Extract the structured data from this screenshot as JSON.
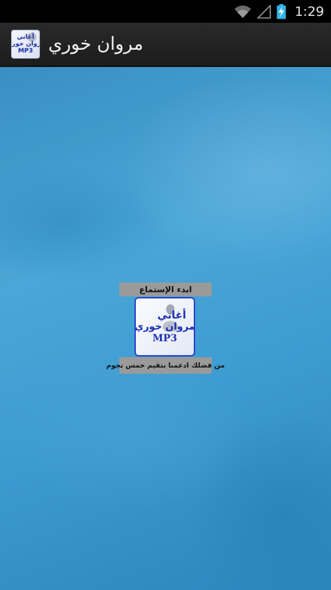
{
  "status_bar": {
    "time": "1:29",
    "icons": [
      "wifi-icon",
      "signal-icon",
      "battery-charging-icon"
    ]
  },
  "action_bar": {
    "title": "مروان خوري",
    "icon_lines": [
      "أغاني",
      "مروان خوري",
      "MP3"
    ]
  },
  "main": {
    "listen_label": "ابدء الإستماع",
    "album_art_lines": [
      "أغاني",
      "مروان خوري",
      "MP3"
    ],
    "rate_label": "من فضلك ادعمنا بتقيم خمس نجوم"
  },
  "colors": {
    "accent_blue": "#2b40c9",
    "button_gray": "#9a9a9a",
    "background_blue": "#3d9cd2"
  }
}
